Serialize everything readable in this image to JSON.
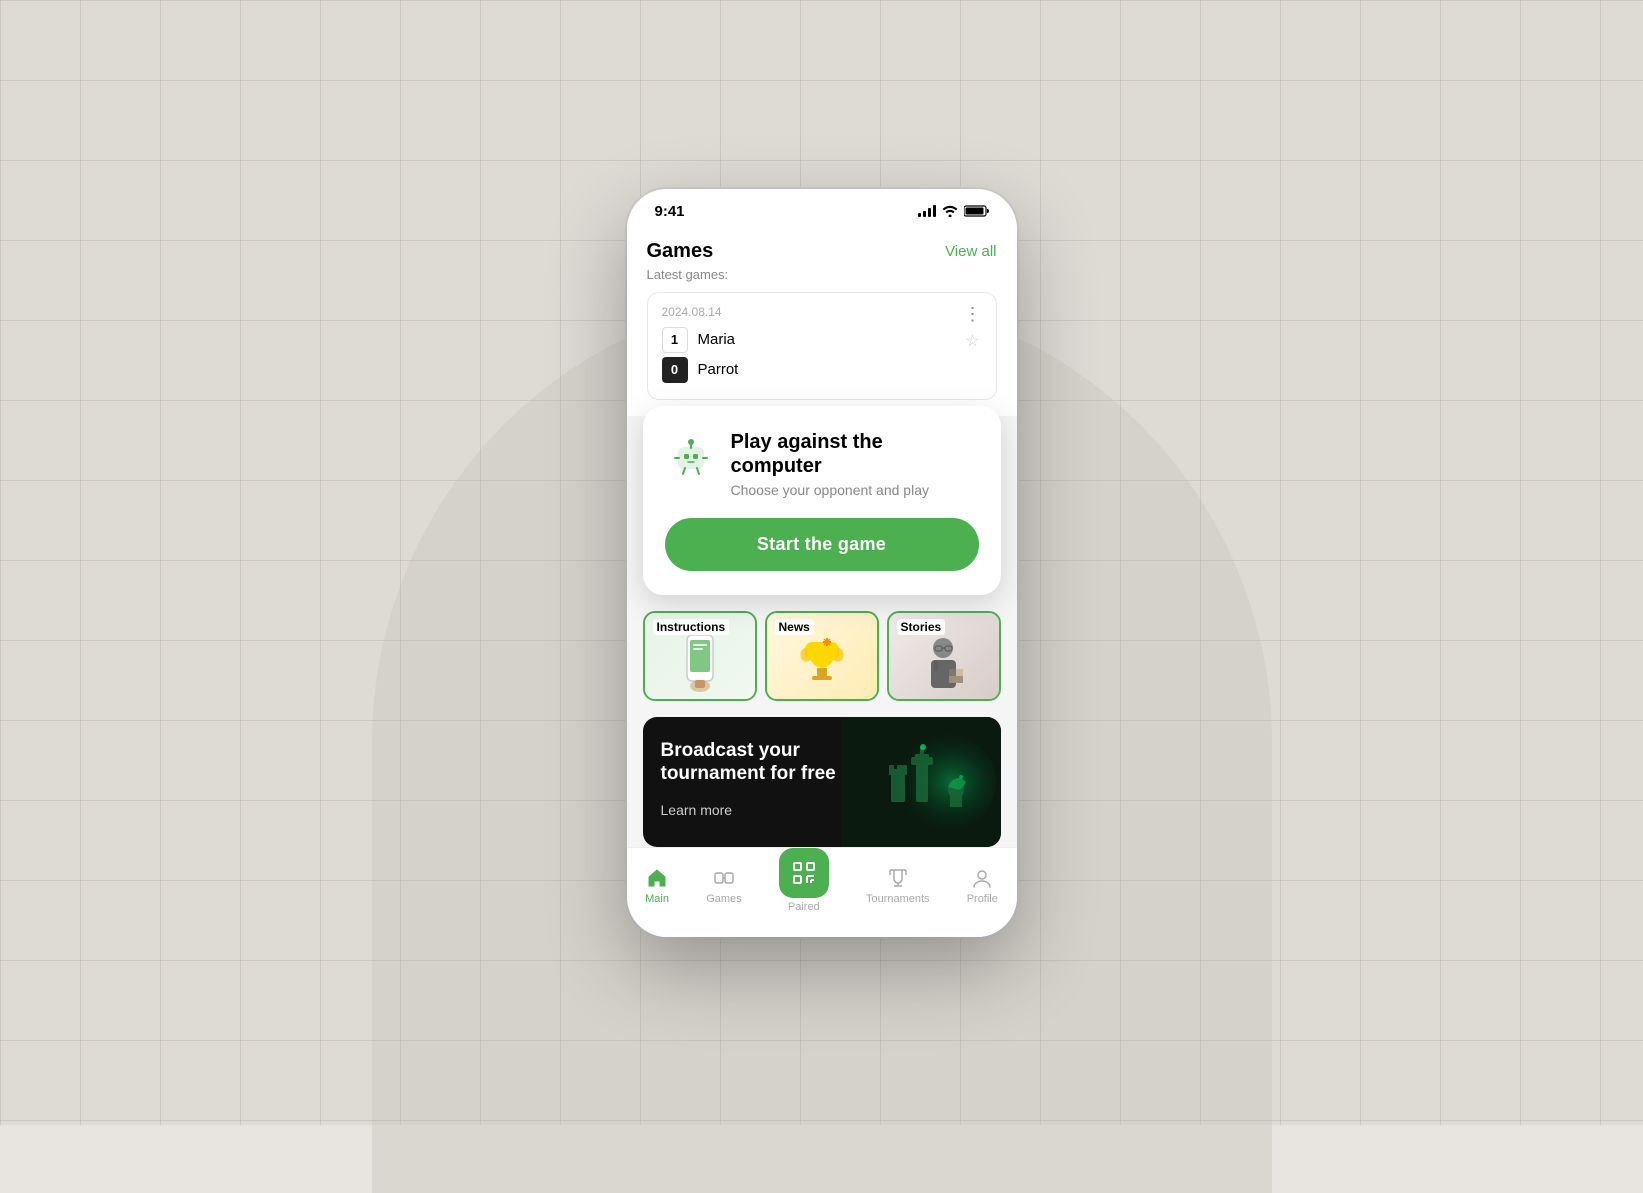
{
  "background": {
    "color": "#dedad4"
  },
  "phone": {
    "status_bar": {
      "time": "9:41",
      "signal": "signal",
      "wifi": "wifi",
      "battery": "battery"
    },
    "games_section": {
      "title": "Games",
      "view_all": "View all",
      "subtitle": "Latest games:",
      "game": {
        "date": "2024.08.14",
        "player1": {
          "score": "1",
          "name": "Maria",
          "score_type": "white"
        },
        "player2": {
          "score": "0",
          "name": "Parrot",
          "score_type": "black"
        }
      }
    },
    "play_card": {
      "title": "Play against the computer",
      "subtitle": "Choose your opponent and play",
      "button_label": "Start the game",
      "button_color": "#4CAF50"
    },
    "categories": [
      {
        "label": "Instructions",
        "type": "instructions"
      },
      {
        "label": "News",
        "type": "news"
      },
      {
        "label": "Stories",
        "type": "stories"
      }
    ],
    "broadcast_banner": {
      "title": "Broadcast your tournament for free",
      "learn_more": "Learn more"
    },
    "bottom_nav": [
      {
        "label": "Main",
        "active": true
      },
      {
        "label": "Games",
        "active": false
      },
      {
        "label": "Paired",
        "active": false,
        "center": true
      },
      {
        "label": "Tournaments",
        "active": false
      },
      {
        "label": "Profile",
        "active": false
      }
    ]
  }
}
